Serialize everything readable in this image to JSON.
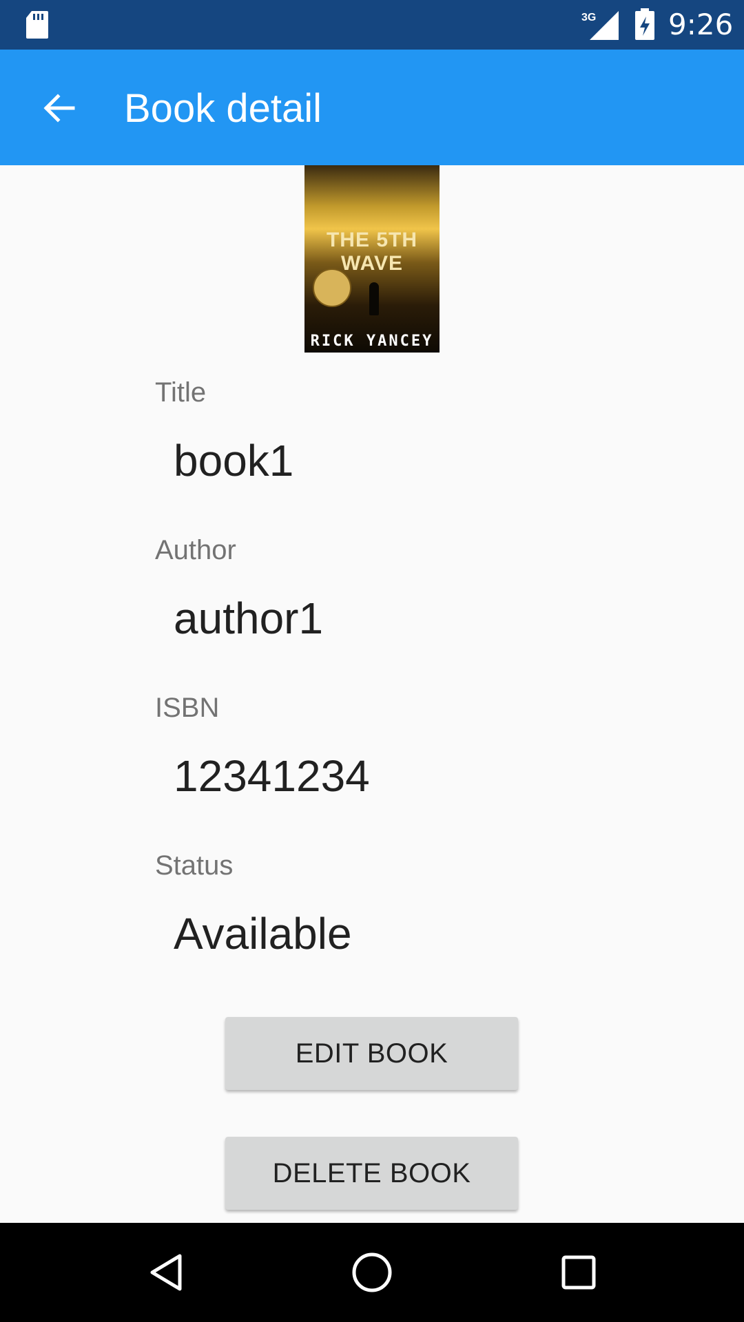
{
  "status_bar": {
    "time": "9:26",
    "network_label": "3G",
    "icons": [
      "sd-card-icon",
      "signal-icon",
      "battery-charging-icon"
    ]
  },
  "app_bar": {
    "title": "Book detail",
    "back_icon": "arrow-back-icon",
    "color": "#2296f3"
  },
  "book": {
    "cover": {
      "title_text": "THE 5TH WAVE",
      "author_text": "RICK YANCEY"
    },
    "fields": [
      {
        "label": "Title",
        "value": "book1"
      },
      {
        "label": "Author",
        "value": "author1"
      },
      {
        "label": "ISBN",
        "value": "12341234"
      },
      {
        "label": "Status",
        "value": "Available"
      }
    ]
  },
  "actions": {
    "edit_label": "EDIT BOOK",
    "delete_label": "DELETE BOOK"
  },
  "nav_bar": {
    "icons": [
      "back-triangle-icon",
      "home-circle-icon",
      "recents-square-icon"
    ]
  }
}
